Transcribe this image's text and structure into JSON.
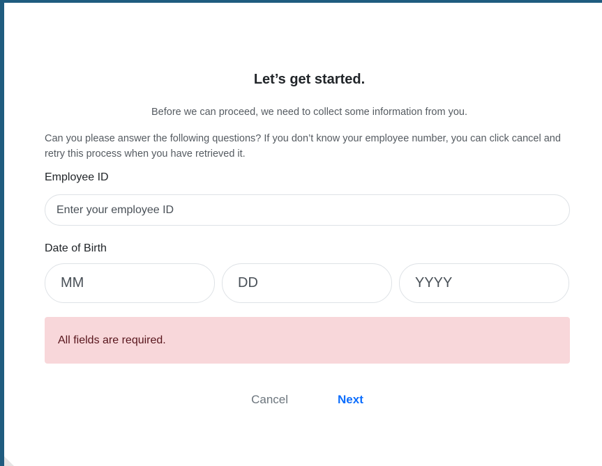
{
  "modal": {
    "title": "Let’s get started.",
    "lead": "Before we can proceed, we need to collect some information from you.",
    "instructions": "Can you please answer the following questions? If you don’t know your employee number, you can click cancel and retry this process when you have retrieved it."
  },
  "form": {
    "employee_id": {
      "label": "Employee ID",
      "placeholder": "Enter your employee ID",
      "value": ""
    },
    "dob": {
      "label": "Date of Birth",
      "month_placeholder": "MM",
      "day_placeholder": "DD",
      "year_placeholder": "YYYY"
    }
  },
  "alert": {
    "message": "All fields are required.",
    "color": "#f8d7da"
  },
  "actions": {
    "cancel_label": "Cancel",
    "next_label": "Next",
    "next_color": "#0d6efd"
  },
  "theme": {
    "frame_border_color": "#1f5c7f"
  }
}
